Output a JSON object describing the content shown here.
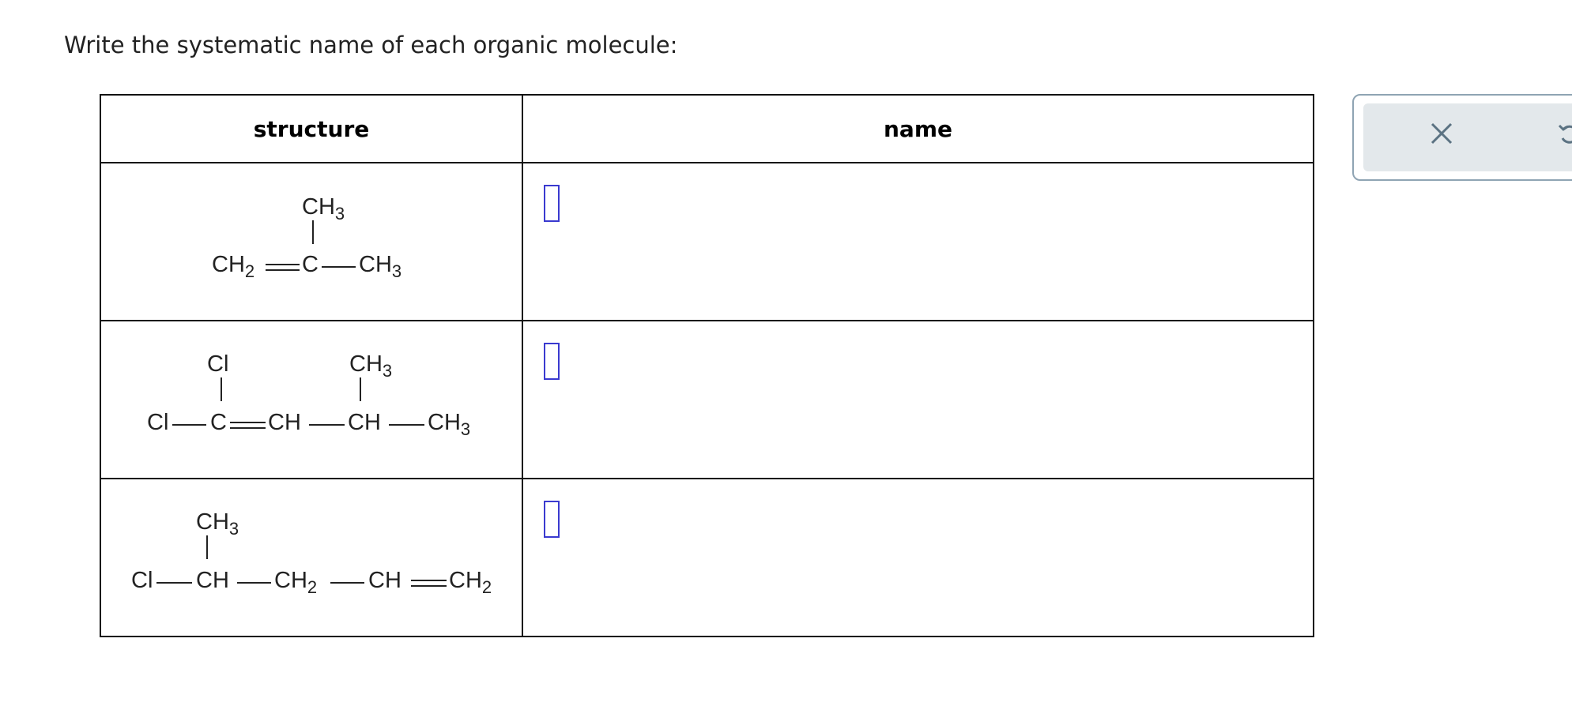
{
  "prompt": "Write the systematic name of each organic molecule:",
  "table": {
    "headers": {
      "structure": "structure",
      "name": "name"
    },
    "rows": [
      {
        "structure": {
          "top_substituent": "CH3",
          "chain": [
            "CH2",
            "C",
            "CH3"
          ],
          "bonds": [
            "double",
            "single"
          ]
        },
        "name_value": ""
      },
      {
        "structure": {
          "top_substituents": [
            "Cl",
            "CH3"
          ],
          "chain": [
            "Cl",
            "C",
            "CH",
            "CH",
            "CH3"
          ],
          "bonds": [
            "single",
            "double",
            "single",
            "single"
          ]
        },
        "name_value": ""
      },
      {
        "structure": {
          "top_substituent": "CH3",
          "chain": [
            "Cl",
            "CH",
            "CH2",
            "CH",
            "CH2"
          ],
          "bonds": [
            "single",
            "single",
            "single",
            "double"
          ]
        },
        "name_value": ""
      }
    ]
  },
  "toolbox": {
    "clear_icon": "x-icon",
    "undo_icon": "undo-icon"
  },
  "colors": {
    "answer_box_border": "#3a3acf",
    "toolbox_border": "#8fa4b3",
    "toolbox_bg": "#e3e8eb",
    "icon": "#5b7282"
  }
}
